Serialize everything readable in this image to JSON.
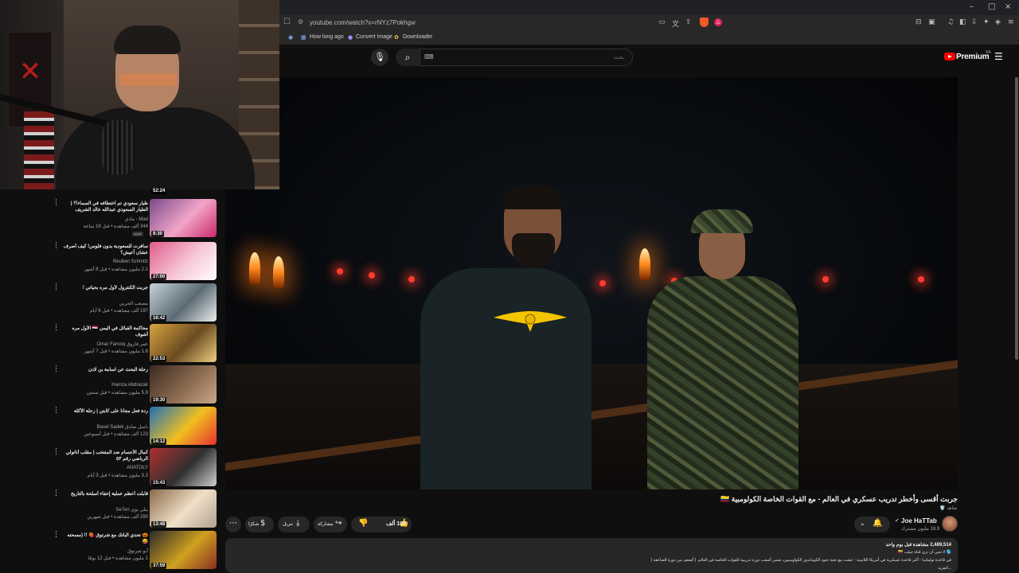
{
  "window": {
    "minimize": "–",
    "maximize": "□",
    "close": "×"
  },
  "browser": {
    "url": "youtube.com/watch?v=rNYz7Pokhgw",
    "bookmarks": [
      {
        "label": "How long ago",
        "icon": "clock-icon"
      },
      {
        "label": "Convert Image",
        "icon": "image-convert-icon"
      },
      {
        "label": "Downloader",
        "icon": "download-icon"
      }
    ]
  },
  "header": {
    "search_placeholder": "بحث",
    "logo_text": "Premium",
    "region": "SA"
  },
  "video": {
    "top_duration": "52:24",
    "title": "جربت أقسى وأخطر تدريب عسكري في العالم - مع القوات الخاصة الكولومبية 🇨🇴",
    "title_tag": "🛡️ شاهد",
    "channel": {
      "name": "Joe HaTTab",
      "subscribers": "18.9 مليون مشترك"
    },
    "actions": {
      "like_count": "109 ألف",
      "share": "مشاركة",
      "download": "تنزيل",
      "thanks": "شكرًا"
    },
    "description": {
      "stats": "2,489,514 مشاهدة  قبل يوم واحد",
      "lines": [
        "🌎 لا تنس أن ترى قناة جيلب 🇨🇴",
        "في قاعدة تولمايدا - أكبر قاعدة عسكرية في أمريكا اللاتينية - عشت مع نخبة جنود الكوماندوز الكولومبيين، ضمن أصعب دورة تدريبية للقوات الخاصة في العالم. ( أضعف من دورة الصاعقة )",
        "...المزيد"
      ]
    }
  },
  "recommendations": [
    {
      "title": "طيار سعودي تم اختطافه في السماء؟! | الطيار السعودي عبدالله خالد الشريف",
      "channel": "Mad - مادي",
      "meta": "344 ألف مشاهدة • قبل 19 ساعة",
      "duration": "8:30",
      "new": "جديد",
      "colors": [
        "#7a4a8a",
        "#f2a6c8",
        "#c9286a"
      ]
    },
    {
      "title": "سافرت للسعودية بدون فلوس! كيف أصرف عشان أعيش؟",
      "channel": "Reuben Schmitz",
      "meta": "2.1 مليون مشاهدة • قبل 8 أشهر",
      "duration": "27:00",
      "new": "",
      "colors": [
        "#e05a8a",
        "#f7c6d8",
        "#ffffff"
      ]
    },
    {
      "title": "جربت الكنترول لأول مره بحياتي !",
      "channel": "مصعب الحربي",
      "meta": "197 ألف مشاهدة • قبل 6 أيام",
      "duration": "16:42",
      "new": "",
      "colors": [
        "#c7d2d8",
        "#5a6b74",
        "#eeeeee"
      ]
    },
    {
      "title": "محاكمة القبائل في اليمن 🇾🇪 الأول مره أشوف",
      "channel": "عمر فاروق Omar Farooq",
      "meta": "1.6 مليون مشاهدة • قبل 7 أشهر",
      "duration": "22:53",
      "new": "",
      "colors": [
        "#d9a441",
        "#6a4a20",
        "#f0d080"
      ]
    },
    {
      "title": "رحلة البحث عن اسامة بن لادن",
      "channel": "Hamza Abdrazak",
      "meta": "5.9 مليون مشاهدة • قبل سنتين",
      "duration": "19:30",
      "new": "",
      "colors": [
        "#3a2a20",
        "#8a6a50",
        "#c9a888"
      ]
    },
    {
      "title": "ردة فعل مجانا على كابتن | رحلة الأكلة",
      "channel": "باسل صادق Basel Sadek",
      "meta": "123 ألف مشاهدة • قبل أسبوعين",
      "duration": "14:12",
      "new": "",
      "colors": [
        "#1f6fb8",
        "#f0c020",
        "#e83030"
      ]
    },
    {
      "title": "كمال الأجسام ضد المنتخب | مقلب أناتولي الرياضي رقم ٥٣",
      "channel": "ANATOLY",
      "meta": "3.3 مليون مشاهدة • قبل 3 أيام",
      "duration": "15:43",
      "new": "",
      "colors": [
        "#b03030",
        "#303030",
        "#d0d0d0"
      ]
    },
    {
      "title": "قابلت أعظم عملية إخفاء أسلحة بالتاريخ",
      "channel": "بيلي بوي Se7en",
      "meta": "290 ألف مشاهدة • قبل شهرين",
      "duration": "13:48",
      "new": "",
      "colors": [
        "#8a6a4a",
        "#f0e0c8",
        "#b0a090"
      ]
    },
    {
      "title": "🎃 تحدي الباتك مع شرتوق 🍓 !! (مسحته 😝",
      "channel": "أبو شرتوق",
      "meta": "1 مليون مشاهدة • قبل 12 يومًا",
      "duration": "37:59",
      "new": "",
      "colors": [
        "#2a2a2a",
        "#d0a020",
        "#8a3020"
      ]
    }
  ]
}
